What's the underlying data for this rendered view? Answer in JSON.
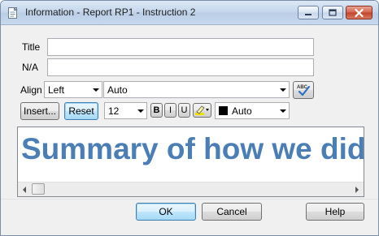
{
  "window": {
    "title": "Information - Report RP1 - Instruction 2",
    "controls": {
      "minimize_icon": "minimize-icon",
      "maximize_icon": "maximize-icon",
      "close_icon": "close-icon"
    }
  },
  "form": {
    "title_label": "Title",
    "title_value": "",
    "na_label": "N/A",
    "na_value": ""
  },
  "align": {
    "label": "Align",
    "align_value": "Left",
    "vertical_value": "Auto",
    "spellcheck_icon": "spellcheck-icon"
  },
  "toolbar": {
    "insert_label": "Insert...",
    "reset_label": "Reset",
    "font_size": "12",
    "bold_label": "B",
    "italic_label": "I",
    "underline_label": "U",
    "highlight_icon": "highlighter-icon",
    "color_value": "Auto",
    "color_swatch": "#000000"
  },
  "editor": {
    "text": "Summary of how we did",
    "text_color": "#4a7eb5"
  },
  "footer": {
    "ok_label": "OK",
    "cancel_label": "Cancel",
    "help_label": "Help"
  }
}
